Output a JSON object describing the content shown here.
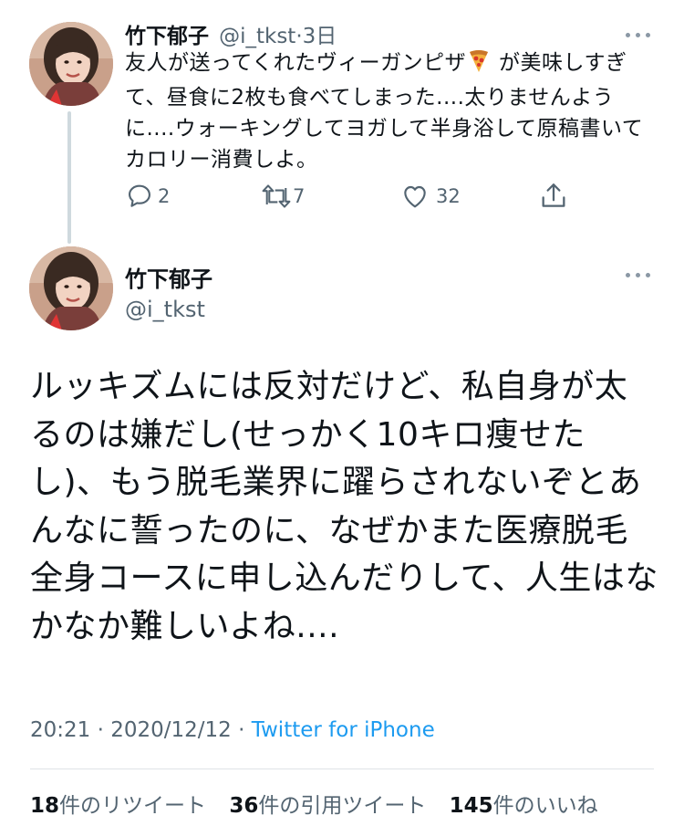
{
  "first_tweet": {
    "author_name": "竹下郁子",
    "handle": "@i_tkst",
    "separator": "·",
    "time_ago": "3日",
    "text_before_emoji": "友人が送ってくれたヴィーガンピザ",
    "emoji": "pizza-icon",
    "text_after_emoji": " が美味しすぎて、昼食に2枚も食べてしまった....太りませんように....ウォーキングしてヨガして半身浴して原稿書いてカロリー消費しよ。",
    "actions": {
      "reply_count": "2",
      "retweet_count": "7",
      "like_count": "32"
    }
  },
  "main_tweet": {
    "author_name": "竹下郁子",
    "handle": "@i_tkst",
    "text": "ルッキズムには反対だけど、私自身が太るのは嫌だし(せっかく10キロ痩せたし)、もう脱毛業界に躍らされないぞとあんなに誓ったのに、なぜかまた医療脱毛全身コースに申し込んだりして、人生はなかなか難しいよね....",
    "time": "20:21",
    "date": "2020/12/12",
    "separator": "·",
    "source": "Twitter for iPhone",
    "stats": {
      "retweets": "18",
      "retweets_label": "件のリツイート",
      "quotes": "36",
      "quotes_label": "件の引用ツイート",
      "likes": "145",
      "likes_label": "件のいいね"
    }
  },
  "colors": {
    "text": "#0f1419",
    "secondary": "#536471",
    "link": "#1d9bf0",
    "thread_line": "#cfd9de"
  }
}
